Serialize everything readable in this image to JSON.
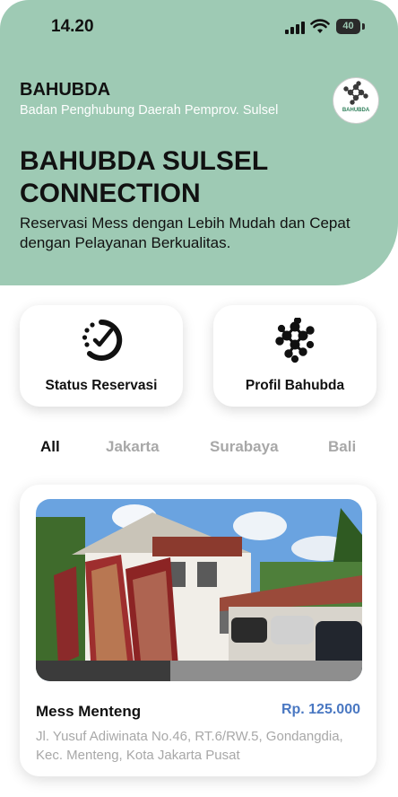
{
  "status_bar": {
    "time": "14.20",
    "battery": "40"
  },
  "header": {
    "org_name": "BAHUBDA",
    "org_subtitle": "Badan Penghubung Daerah Pemprov. Sulsel",
    "logo_text": "BAHUBDA",
    "headline": "BAHUBDA SULSEL CONNECTION",
    "tagline": "Reservasi Mess dengan Lebih Mudah dan Cepat dengan Pelayanan Berkualitas."
  },
  "actions": [
    {
      "label": "Status Reservasi",
      "icon": "clock-check-icon"
    },
    {
      "label": "Profil Bahubda",
      "icon": "network-icon"
    }
  ],
  "filters": [
    {
      "label": "All",
      "active": true
    },
    {
      "label": "Jakarta",
      "active": false
    },
    {
      "label": "Surabaya",
      "active": false
    },
    {
      "label": "Bali",
      "active": false
    }
  ],
  "mess": {
    "name": "Mess Menteng",
    "price": "Rp. 125.000",
    "address": "Jl. Yusuf Adiwinata No.46, RT.6/RW.5, Gondangdia, Kec. Menteng, Kota Jakarta Pusat"
  },
  "colors": {
    "hero": "#9ecab4",
    "price": "#4a78c2",
    "muted": "#a8a8a8"
  }
}
